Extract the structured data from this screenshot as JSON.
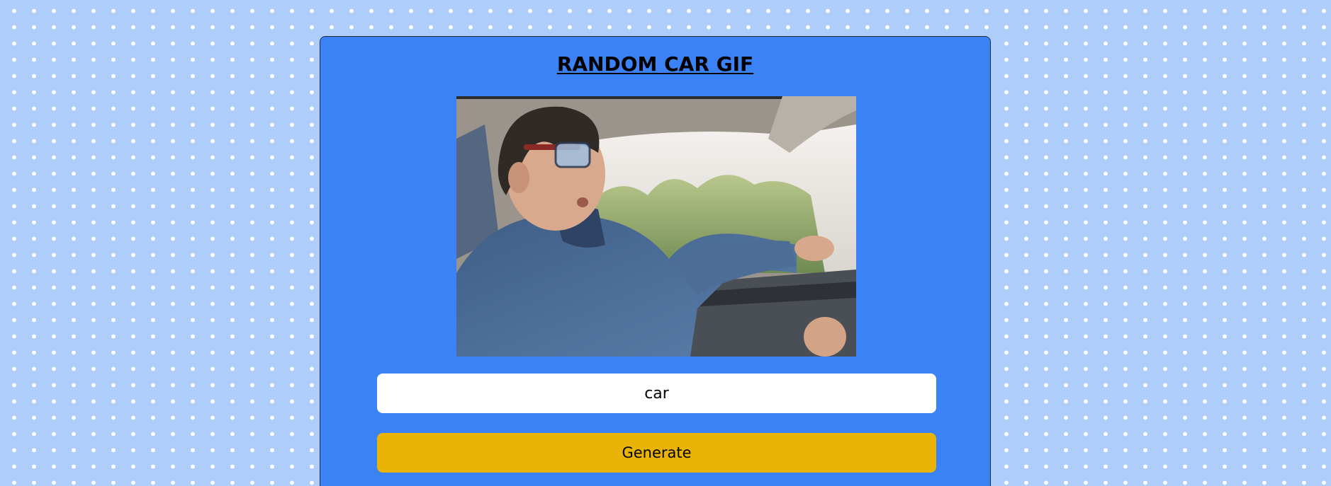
{
  "page": {
    "title": "RANDOM CAR GIF"
  },
  "gif": {
    "alt": "car"
  },
  "search": {
    "value": "car"
  },
  "actions": {
    "generate_label": "Generate"
  },
  "colors": {
    "background": "#aecdfa",
    "dots": "#ffffff",
    "card": "#3b82f6",
    "button": "#eab308",
    "input": "#ffffff"
  }
}
